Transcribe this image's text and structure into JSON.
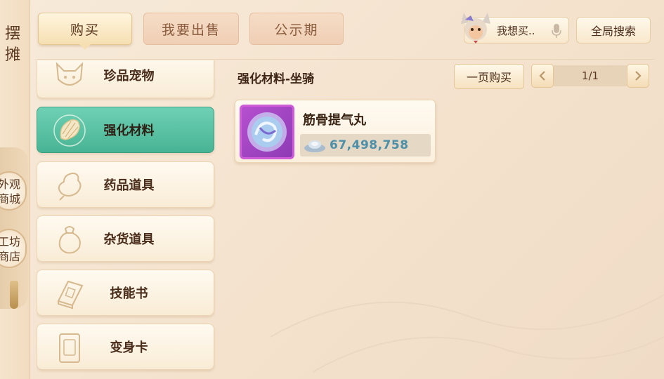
{
  "sidebar": {
    "title_chars": [
      "摆",
      "摊"
    ],
    "badges": [
      {
        "lines": [
          "外观",
          "商城"
        ]
      },
      {
        "lines": [
          "工坊",
          "商店"
        ]
      }
    ]
  },
  "tabs": [
    {
      "label": "购买",
      "active": true
    },
    {
      "label": "我要出售",
      "active": false
    },
    {
      "label": "公示期",
      "active": false
    }
  ],
  "header": {
    "want_buy_label": "我想买..",
    "global_search_label": "全局搜索"
  },
  "categories": [
    {
      "label": "珍品宠物",
      "icon": "cat-mask-icon",
      "active": false
    },
    {
      "label": "强化材料",
      "icon": "crystal-icon",
      "active": true
    },
    {
      "label": "药品道具",
      "icon": "gourd-icon",
      "active": false
    },
    {
      "label": "杂货道具",
      "icon": "pouch-icon",
      "active": false
    },
    {
      "label": "技能书",
      "icon": "book-icon",
      "active": false
    },
    {
      "label": "变身卡",
      "icon": "card-icon",
      "active": false
    }
  ],
  "listing": {
    "subtitle": "强化材料-坐骑",
    "page_buy_label": "一页购买",
    "pager_text": "1/1",
    "items": [
      {
        "name": "筋骨提气丸",
        "price": "67,498,758",
        "currency_icon": "silver-ingot-icon"
      }
    ]
  },
  "colors": {
    "active_category": "#48b494",
    "price_text": "#4c8fa8",
    "item_border": "#d05cd8"
  }
}
